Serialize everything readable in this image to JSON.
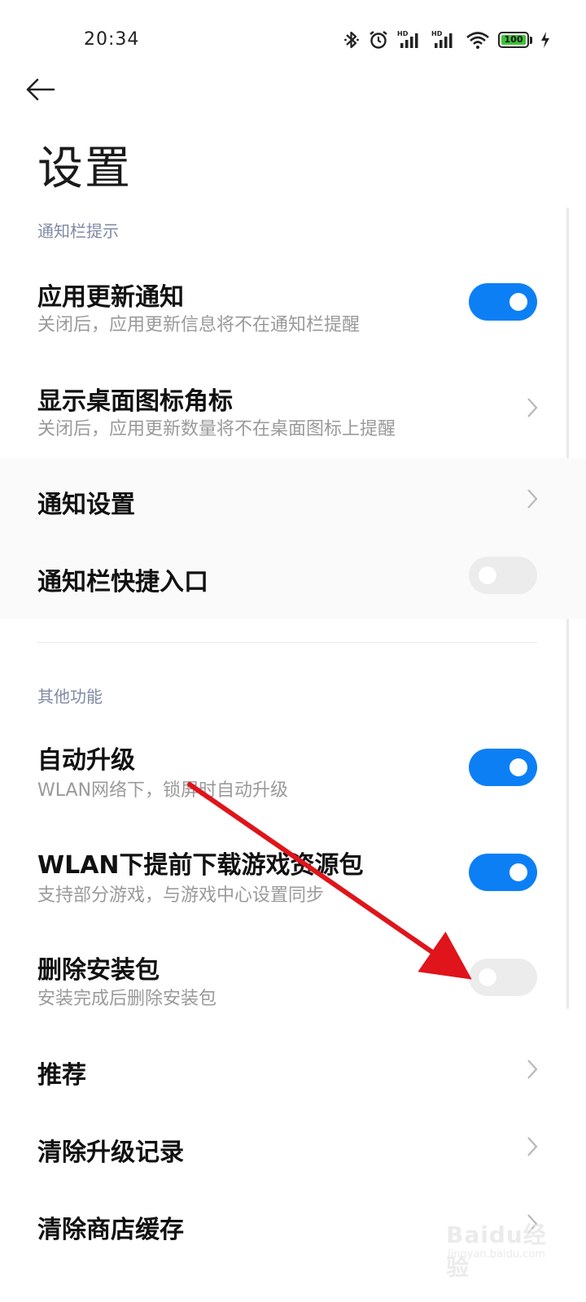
{
  "status_bar": {
    "time": "20:34",
    "battery_level": "100",
    "icons": [
      "bluetooth-icon",
      "alarm-icon",
      "hd-signal-icon",
      "hd-signal-icon",
      "wifi-icon",
      "battery-icon",
      "charging-icon"
    ]
  },
  "header": {
    "title": "设置"
  },
  "sections": {
    "notification": {
      "header": "通知栏提示"
    },
    "other": {
      "header": "其他功能"
    }
  },
  "rows": {
    "app_update_notify": {
      "title": "应用更新通知",
      "subtitle": "关闭后，应用更新信息将不在通知栏提醒",
      "toggle": true
    },
    "desktop_badge": {
      "title": "显示桌面图标角标",
      "subtitle": "关闭后，应用更新数量将不在桌面图标上提醒"
    },
    "notify_settings": {
      "title": "通知设置"
    },
    "notify_shortcut": {
      "title": "通知栏快捷入口",
      "toggle": false
    },
    "auto_upgrade": {
      "title": "自动升级",
      "subtitle": "WLAN网络下，锁屏时自动升级",
      "toggle": true
    },
    "wlan_predownload": {
      "title": "WLAN下提前下载游戏资源包",
      "subtitle": "支持部分游戏，与游戏中心设置同步",
      "toggle": true
    },
    "delete_package": {
      "title": "删除安装包",
      "subtitle": "安装完成后删除安装包",
      "toggle": false
    },
    "recommend": {
      "title": "推荐"
    },
    "clear_upgrade_records": {
      "title": "清除升级记录"
    },
    "clear_store_cache": {
      "title": "清除商店缓存"
    }
  },
  "watermark": {
    "text": "Baidu经验",
    "url": "jingyan.baidu.com"
  },
  "colors": {
    "accent": "#0d7ff5",
    "toggle_off": "#ececec",
    "section_header": "#7f8aa3",
    "annotation_arrow": "#e0141b"
  }
}
